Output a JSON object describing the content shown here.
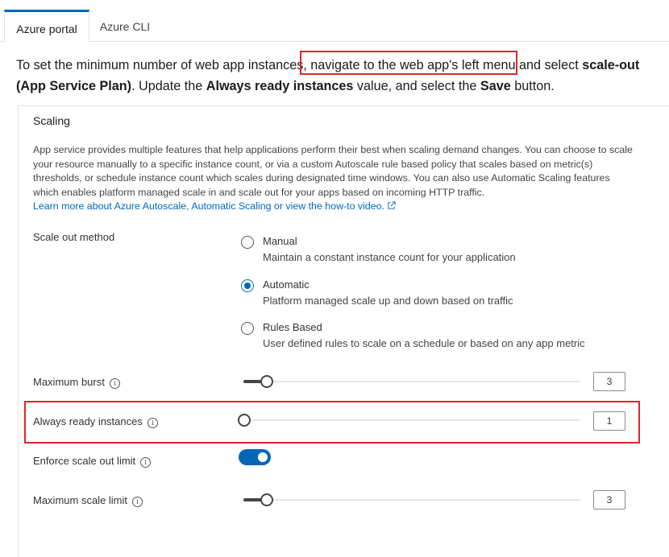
{
  "tabs": [
    {
      "label": "Azure portal",
      "active": true
    },
    {
      "label": "Azure CLI",
      "active": false
    }
  ],
  "intro": {
    "part1": "To set the minimum number of web app instances, navigate to the web app's left menu and select ",
    "bold1": "scale-out (App Service Plan)",
    "part2": ". Update the ",
    "bold2": "Always ready instances",
    "part3": " value, and select the ",
    "bold3": "Save",
    "part4": " button."
  },
  "scaling": {
    "title": "Scaling",
    "description": "App service provides multiple features that help applications perform their best when scaling demand changes. You can choose to scale your resource manually to a specific instance count, or via a custom Autoscale rule based policy that scales based on metric(s) thresholds, or schedule instance count which scales during designated time windows. You can also use Automatic Scaling features which enables platform managed scale in and scale out for your apps based on incoming HTTP traffic.",
    "learn_more": "Learn more about Azure Autoscale, Automatic Scaling or view the how-to video.",
    "scale_out_method_label": "Scale out method",
    "options": [
      {
        "label": "Manual",
        "sub": "Maintain a constant instance count for your application",
        "checked": false
      },
      {
        "label": "Automatic",
        "sub": "Platform managed scale up and down based on traffic",
        "checked": true
      },
      {
        "label": "Rules Based",
        "sub": "User defined rules to scale on a schedule or based on any app metric",
        "checked": false
      }
    ],
    "maximum_burst": {
      "label": "Maximum burst",
      "value": "3",
      "level": 0.07
    },
    "always_ready": {
      "label": "Always ready instances",
      "value": "1",
      "level": 0.0
    },
    "enforce_limit": {
      "label": "Enforce scale out limit",
      "enabled": true
    },
    "maximum_scale_limit": {
      "label": "Maximum scale limit",
      "value": "3",
      "level": 0.07
    }
  },
  "colors": {
    "accent": "#0067b8",
    "highlight": "#e3242b"
  }
}
